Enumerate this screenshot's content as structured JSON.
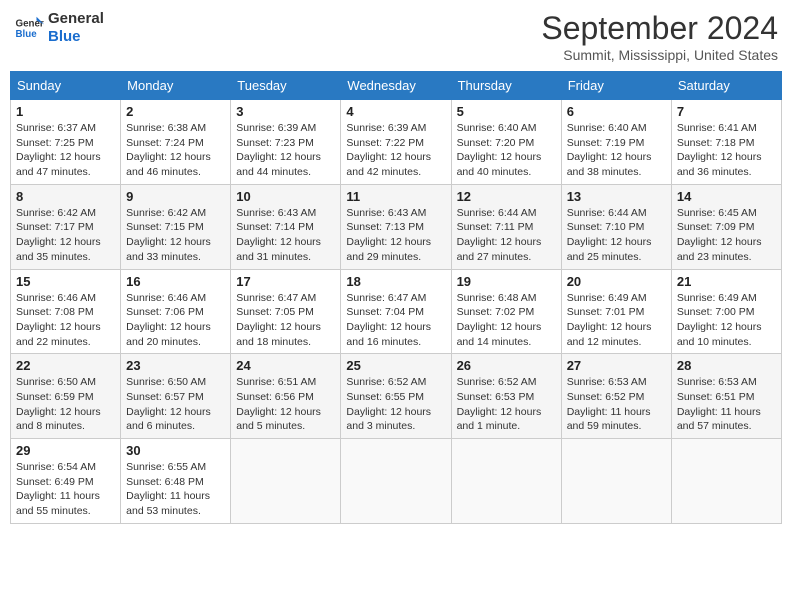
{
  "logo": {
    "text_general": "General",
    "text_blue": "Blue"
  },
  "title": "September 2024",
  "subtitle": "Summit, Mississippi, United States",
  "weekdays": [
    "Sunday",
    "Monday",
    "Tuesday",
    "Wednesday",
    "Thursday",
    "Friday",
    "Saturday"
  ],
  "weeks": [
    [
      {
        "day": "1",
        "sunrise": "6:37 AM",
        "sunset": "7:25 PM",
        "daylight": "12 hours and 47 minutes."
      },
      {
        "day": "2",
        "sunrise": "6:38 AM",
        "sunset": "7:24 PM",
        "daylight": "12 hours and 46 minutes."
      },
      {
        "day": "3",
        "sunrise": "6:39 AM",
        "sunset": "7:23 PM",
        "daylight": "12 hours and 44 minutes."
      },
      {
        "day": "4",
        "sunrise": "6:39 AM",
        "sunset": "7:22 PM",
        "daylight": "12 hours and 42 minutes."
      },
      {
        "day": "5",
        "sunrise": "6:40 AM",
        "sunset": "7:20 PM",
        "daylight": "12 hours and 40 minutes."
      },
      {
        "day": "6",
        "sunrise": "6:40 AM",
        "sunset": "7:19 PM",
        "daylight": "12 hours and 38 minutes."
      },
      {
        "day": "7",
        "sunrise": "6:41 AM",
        "sunset": "7:18 PM",
        "daylight": "12 hours and 36 minutes."
      }
    ],
    [
      {
        "day": "8",
        "sunrise": "6:42 AM",
        "sunset": "7:17 PM",
        "daylight": "12 hours and 35 minutes."
      },
      {
        "day": "9",
        "sunrise": "6:42 AM",
        "sunset": "7:15 PM",
        "daylight": "12 hours and 33 minutes."
      },
      {
        "day": "10",
        "sunrise": "6:43 AM",
        "sunset": "7:14 PM",
        "daylight": "12 hours and 31 minutes."
      },
      {
        "day": "11",
        "sunrise": "6:43 AM",
        "sunset": "7:13 PM",
        "daylight": "12 hours and 29 minutes."
      },
      {
        "day": "12",
        "sunrise": "6:44 AM",
        "sunset": "7:11 PM",
        "daylight": "12 hours and 27 minutes."
      },
      {
        "day": "13",
        "sunrise": "6:44 AM",
        "sunset": "7:10 PM",
        "daylight": "12 hours and 25 minutes."
      },
      {
        "day": "14",
        "sunrise": "6:45 AM",
        "sunset": "7:09 PM",
        "daylight": "12 hours and 23 minutes."
      }
    ],
    [
      {
        "day": "15",
        "sunrise": "6:46 AM",
        "sunset": "7:08 PM",
        "daylight": "12 hours and 22 minutes."
      },
      {
        "day": "16",
        "sunrise": "6:46 AM",
        "sunset": "7:06 PM",
        "daylight": "12 hours and 20 minutes."
      },
      {
        "day": "17",
        "sunrise": "6:47 AM",
        "sunset": "7:05 PM",
        "daylight": "12 hours and 18 minutes."
      },
      {
        "day": "18",
        "sunrise": "6:47 AM",
        "sunset": "7:04 PM",
        "daylight": "12 hours and 16 minutes."
      },
      {
        "day": "19",
        "sunrise": "6:48 AM",
        "sunset": "7:02 PM",
        "daylight": "12 hours and 14 minutes."
      },
      {
        "day": "20",
        "sunrise": "6:49 AM",
        "sunset": "7:01 PM",
        "daylight": "12 hours and 12 minutes."
      },
      {
        "day": "21",
        "sunrise": "6:49 AM",
        "sunset": "7:00 PM",
        "daylight": "12 hours and 10 minutes."
      }
    ],
    [
      {
        "day": "22",
        "sunrise": "6:50 AM",
        "sunset": "6:59 PM",
        "daylight": "12 hours and 8 minutes."
      },
      {
        "day": "23",
        "sunrise": "6:50 AM",
        "sunset": "6:57 PM",
        "daylight": "12 hours and 6 minutes."
      },
      {
        "day": "24",
        "sunrise": "6:51 AM",
        "sunset": "6:56 PM",
        "daylight": "12 hours and 5 minutes."
      },
      {
        "day": "25",
        "sunrise": "6:52 AM",
        "sunset": "6:55 PM",
        "daylight": "12 hours and 3 minutes."
      },
      {
        "day": "26",
        "sunrise": "6:52 AM",
        "sunset": "6:53 PM",
        "daylight": "12 hours and 1 minute."
      },
      {
        "day": "27",
        "sunrise": "6:53 AM",
        "sunset": "6:52 PM",
        "daylight": "11 hours and 59 minutes."
      },
      {
        "day": "28",
        "sunrise": "6:53 AM",
        "sunset": "6:51 PM",
        "daylight": "11 hours and 57 minutes."
      }
    ],
    [
      {
        "day": "29",
        "sunrise": "6:54 AM",
        "sunset": "6:49 PM",
        "daylight": "11 hours and 55 minutes."
      },
      {
        "day": "30",
        "sunrise": "6:55 AM",
        "sunset": "6:48 PM",
        "daylight": "11 hours and 53 minutes."
      },
      null,
      null,
      null,
      null,
      null
    ]
  ]
}
